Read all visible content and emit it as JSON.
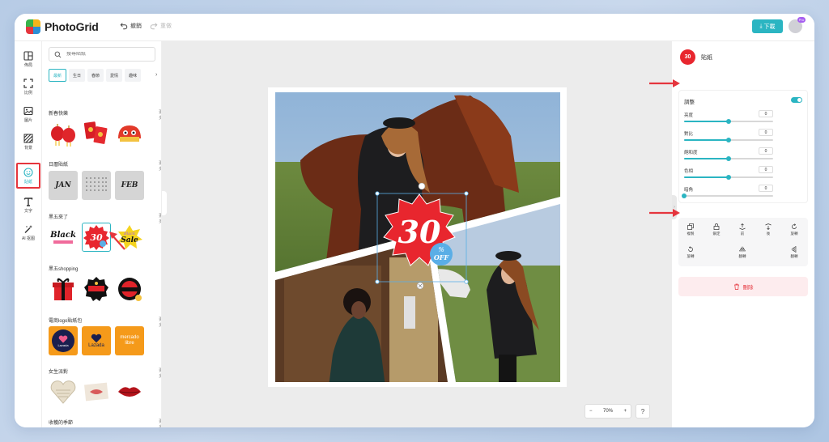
{
  "app": {
    "brand": "PhotoGrid"
  },
  "header": {
    "undo_label": "撤銷",
    "redo_label": "重做",
    "download_label": "下載",
    "pro_badge": "Pro"
  },
  "nav": {
    "items": [
      {
        "label": "佈局",
        "icon": "layout-icon"
      },
      {
        "label": "比例",
        "icon": "ratio-icon"
      },
      {
        "label": "圖片",
        "icon": "image-icon"
      },
      {
        "label": "背景",
        "icon": "background-icon"
      },
      {
        "label": "貼紙",
        "icon": "sticker-icon"
      },
      {
        "label": "文字",
        "icon": "text-icon"
      },
      {
        "label": "AI 抠图",
        "icon": "ai-cutout-icon"
      }
    ]
  },
  "panel": {
    "search_placeholder": "搜尋貼紙",
    "categories": [
      "最新",
      "生日",
      "春節",
      "愛情",
      "趣味"
    ],
    "more_label": "更多",
    "sections": [
      {
        "title": "新春快樂"
      },
      {
        "title": "日曆貼紙"
      },
      {
        "title": "黑五來了"
      },
      {
        "title": "黑五shopping"
      },
      {
        "title": "電商logo貼紙包"
      },
      {
        "title": "女生派對"
      },
      {
        "title": "收穫的季節"
      }
    ],
    "calendar_labels": [
      "JAN",
      "FEB"
    ],
    "blackfriday": {
      "black_text": "Black",
      "sale_text": "Sale",
      "sale_black": "Black",
      "number": "30"
    },
    "shop_logos": [
      "Lazada",
      "Lazada",
      "mercado libre"
    ]
  },
  "canvas": {
    "sticker": {
      "number": "30",
      "percent": "%",
      "off": "OFF"
    },
    "zoom": {
      "minus": "−",
      "value": "70%",
      "plus": "+",
      "help": "?"
    }
  },
  "right": {
    "title": "貼紙",
    "icon_text": "30",
    "adjust": {
      "title": "調整",
      "sliders": [
        {
          "label": "亮度",
          "value": "0",
          "percent": 50
        },
        {
          "label": "對比",
          "value": "0",
          "percent": 50
        },
        {
          "label": "飽和度",
          "value": "0",
          "percent": 50
        },
        {
          "label": "色相",
          "value": "0",
          "percent": 50
        },
        {
          "label": "暗角",
          "value": "0",
          "percent": 0
        }
      ]
    },
    "tools": [
      {
        "label": "複製",
        "icon": "copy-icon"
      },
      {
        "label": "鎖定",
        "icon": "lock-icon"
      },
      {
        "label": "前",
        "icon": "bring-forward-icon"
      },
      {
        "label": "後",
        "icon": "send-backward-icon"
      },
      {
        "label": "旋轉",
        "icon": "rotate-icon"
      },
      {
        "label": "旋轉",
        "icon": "rotate-left-icon"
      },
      {
        "label": "翻轉",
        "icon": "flip-horizontal-icon"
      },
      {
        "label": "翻轉",
        "icon": "flip-vertical-icon"
      }
    ],
    "delete_label": "刪除"
  },
  "colors": {
    "accent": "#2bb5c2",
    "highlight": "#e5353d",
    "pro": "#a65ef0"
  }
}
